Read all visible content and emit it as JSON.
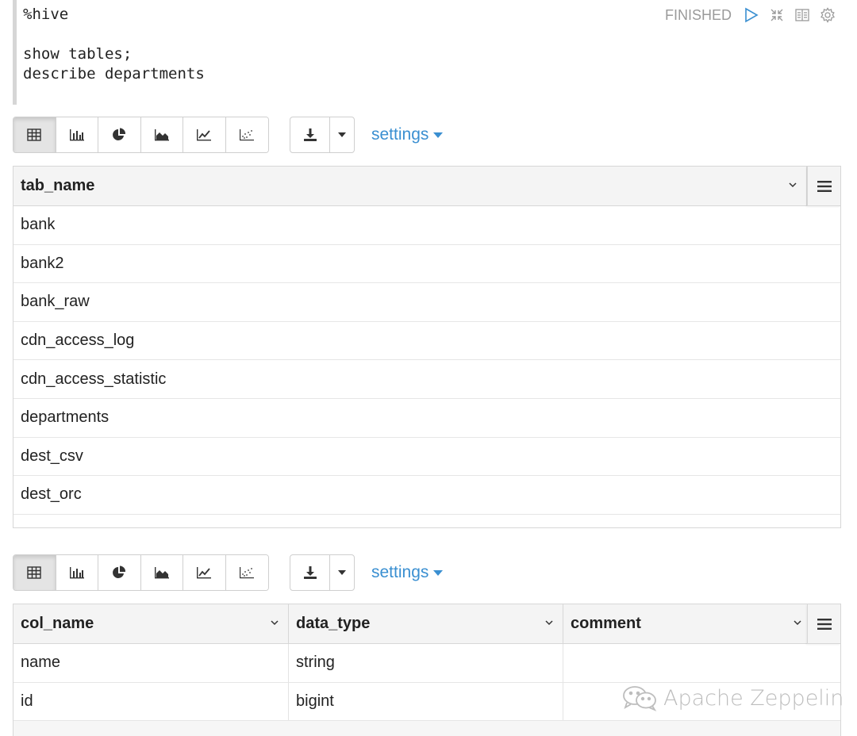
{
  "editor": {
    "lines": [
      "%hive",
      "",
      "show tables;",
      "describe departments"
    ]
  },
  "paragraph": {
    "status": "FINISHED",
    "controls": [
      "run-icon",
      "collapse-icon",
      "book-icon",
      "gear-icon"
    ]
  },
  "toolbar": {
    "view_buttons": [
      "table-icon",
      "bar-chart-icon",
      "pie-chart-icon",
      "area-chart-icon",
      "line-chart-icon",
      "scatter-chart-icon"
    ],
    "active_view": "table-icon",
    "download_icon": "download-icon",
    "settings_label": "settings"
  },
  "table1": {
    "columns": [
      "tab_name"
    ],
    "rows": [
      [
        "bank"
      ],
      [
        "bank2"
      ],
      [
        "bank_raw"
      ],
      [
        "cdn_access_log"
      ],
      [
        "cdn_access_statistic"
      ],
      [
        "departments"
      ],
      [
        "dest_csv"
      ],
      [
        "dest_orc"
      ]
    ]
  },
  "table2": {
    "columns": [
      "col_name",
      "data_type",
      "comment"
    ],
    "rows": [
      [
        "name",
        "string",
        ""
      ],
      [
        "id",
        "bigint",
        ""
      ]
    ]
  },
  "watermark": {
    "text": "Apache Zeppelin"
  },
  "colors": {
    "link": "#3a8fd1",
    "status": "#9a9a9a",
    "header_bg": "#f4f4f4",
    "border": "#d7d7d7"
  }
}
